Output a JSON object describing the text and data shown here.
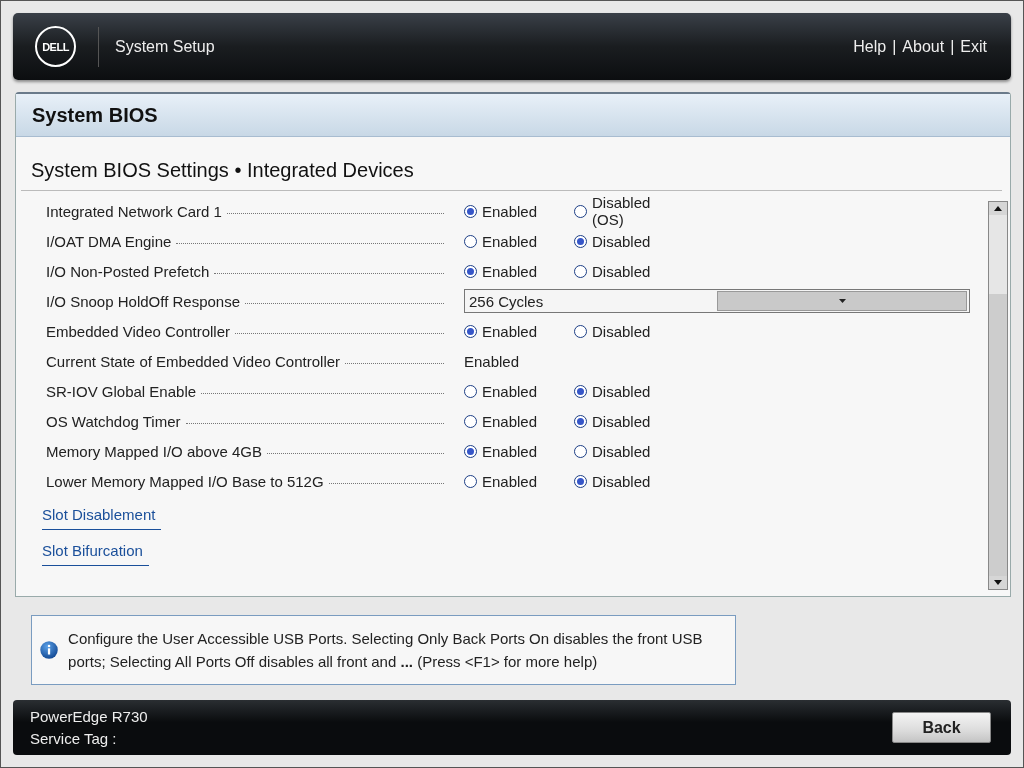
{
  "header": {
    "logo_text": "DELL",
    "title": "System Setup",
    "menu": [
      {
        "label": "Help"
      },
      {
        "label": "About"
      },
      {
        "label": "Exit"
      }
    ],
    "separator": "|"
  },
  "panel": {
    "title": "System BIOS",
    "subtitle": "System BIOS Settings • Integrated Devices"
  },
  "settings": [
    {
      "label": "Integrated Network Card 1",
      "kind": "radio",
      "options": [
        {
          "label": "Enabled",
          "selected": true
        },
        {
          "label": "Disabled (OS)",
          "selected": false
        }
      ]
    },
    {
      "label": "I/OAT DMA Engine",
      "kind": "radio",
      "options": [
        {
          "label": "Enabled",
          "selected": false
        },
        {
          "label": "Disabled",
          "selected": true
        }
      ]
    },
    {
      "label": "I/O Non-Posted Prefetch",
      "kind": "radio",
      "options": [
        {
          "label": "Enabled",
          "selected": true
        },
        {
          "label": "Disabled",
          "selected": false
        }
      ]
    },
    {
      "label": "I/O Snoop HoldOff Response",
      "kind": "dropdown",
      "value": "256 Cycles"
    },
    {
      "label": "Embedded Video Controller",
      "kind": "radio",
      "options": [
        {
          "label": "Enabled",
          "selected": true
        },
        {
          "label": "Disabled",
          "selected": false
        }
      ]
    },
    {
      "label": "Current State of Embedded Video Controller",
      "kind": "text",
      "value": "Enabled"
    },
    {
      "label": "SR-IOV Global Enable",
      "kind": "radio",
      "options": [
        {
          "label": "Enabled",
          "selected": false
        },
        {
          "label": "Disabled",
          "selected": true
        }
      ]
    },
    {
      "label": "OS Watchdog Timer",
      "kind": "radio",
      "options": [
        {
          "label": "Enabled",
          "selected": false
        },
        {
          "label": "Disabled",
          "selected": true
        }
      ]
    },
    {
      "label": "Memory Mapped I/O above 4GB",
      "kind": "radio",
      "options": [
        {
          "label": "Enabled",
          "selected": true
        },
        {
          "label": "Disabled",
          "selected": false
        }
      ]
    },
    {
      "label": "Lower Memory Mapped I/O Base to 512G",
      "kind": "radio",
      "options": [
        {
          "label": "Enabled",
          "selected": false
        },
        {
          "label": "Disabled",
          "selected": true
        }
      ]
    }
  ],
  "links": [
    {
      "label": "Slot Disablement"
    },
    {
      "label": "Slot Bifurcation"
    }
  ],
  "help_text": "Configure the User Accessible USB Ports. Selecting Only Back Ports On disables the front USB ports; Selecting All Ports Off disables all front and **...** (Press <F1> for more help)",
  "footer": {
    "model": "PowerEdge R730",
    "service_tag": "Service Tag :",
    "back_button": "Back"
  }
}
